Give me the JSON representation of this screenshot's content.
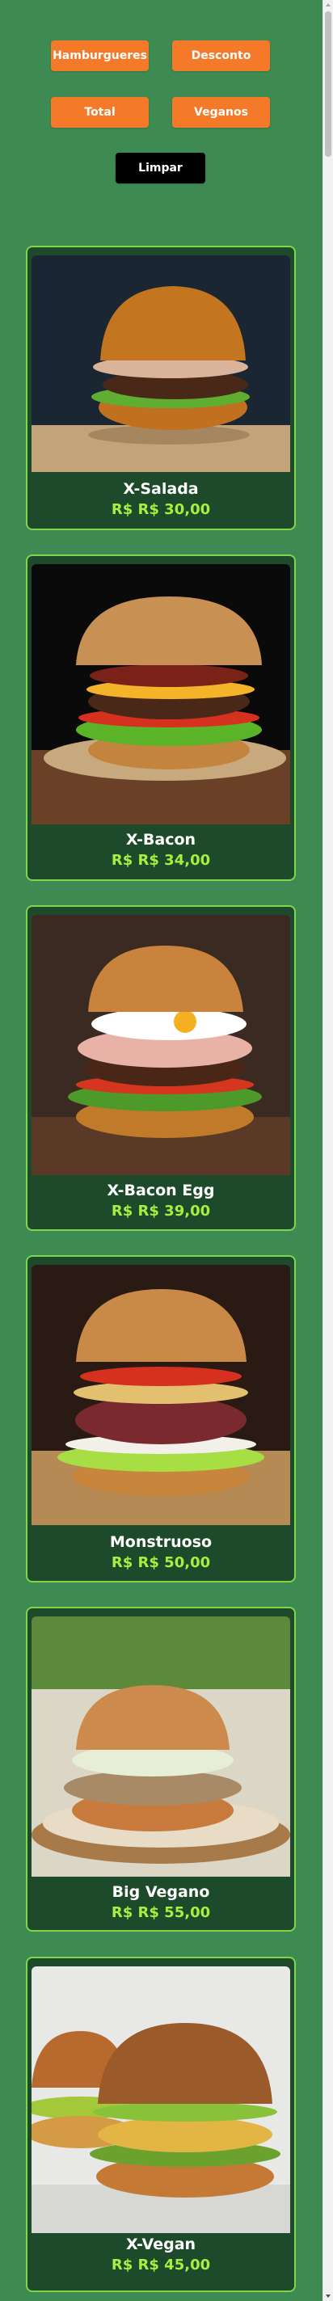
{
  "filters": {
    "hamburgers_label": "Hamburgueres",
    "discount_label": "Desconto",
    "total_label": "Total",
    "vegan_label": "Veganos",
    "clear_label": "Limpar"
  },
  "products": [
    {
      "name": "X-Salada",
      "price": "R$ R$ 30,00"
    },
    {
      "name": "X-Bacon",
      "price": "R$ R$ 34,00"
    },
    {
      "name": "X-Bacon Egg",
      "price": "R$ R$ 39,00"
    },
    {
      "name": "Monstruoso",
      "price": "R$ R$ 50,00"
    },
    {
      "name": "Big Vegano",
      "price": "R$ R$ 55,00"
    },
    {
      "name": "X-Vegan",
      "price": "R$ R$ 45,00"
    }
  ],
  "colors": {
    "page_background": "#3e8a53",
    "button_orange": "#f47a2a",
    "button_black": "#000000",
    "card_background": "#1e4a2c",
    "card_border": "#7fd64a",
    "price_green": "#a6ee3f"
  }
}
